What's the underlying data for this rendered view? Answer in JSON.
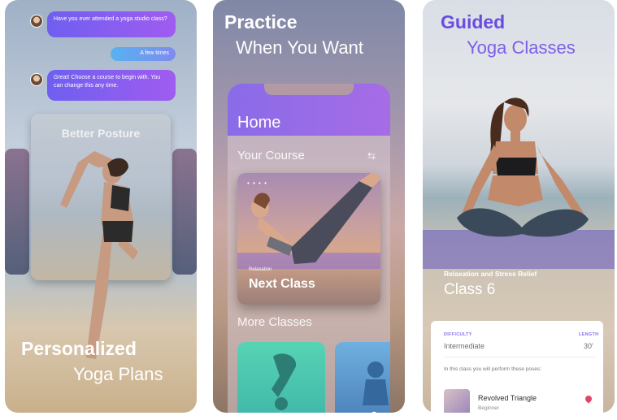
{
  "panel1": {
    "chat": [
      {
        "text": "Have you ever attended a yoga studio class?"
      },
      {
        "reply": "A few times"
      },
      {
        "text": "Great! Choose a course to begin with. You can change this any time."
      }
    ],
    "card_title": "Better Posture",
    "headline_bold": "Personalized",
    "headline_light": "Yoga Plans"
  },
  "panel2": {
    "headline_bold": "Practice",
    "headline_light": "When You Want",
    "screen": {
      "title": "Home",
      "section": "Your Course",
      "card_tag": "Relaxation",
      "card_title": "Next Class",
      "more": "More Classes"
    }
  },
  "panel3": {
    "headline_bold": "Guided",
    "headline_light": "Yoga Classes",
    "overlay_tag": "Relaxation and Stress Relief",
    "overlay_title": "Class 6",
    "info": {
      "difficulty_label": "DIFFICULTY",
      "difficulty_value": "Intermediate",
      "length_label": "LENGTH",
      "length_value": "30'",
      "note": "In this class you will perform these poses:",
      "pose_name": "Revolved Triangle",
      "pose_level": "Beginner"
    }
  },
  "colors": {
    "purple": "#8a6be8",
    "blue": "#57b2f0",
    "accent_text": "#6a4ce0"
  }
}
